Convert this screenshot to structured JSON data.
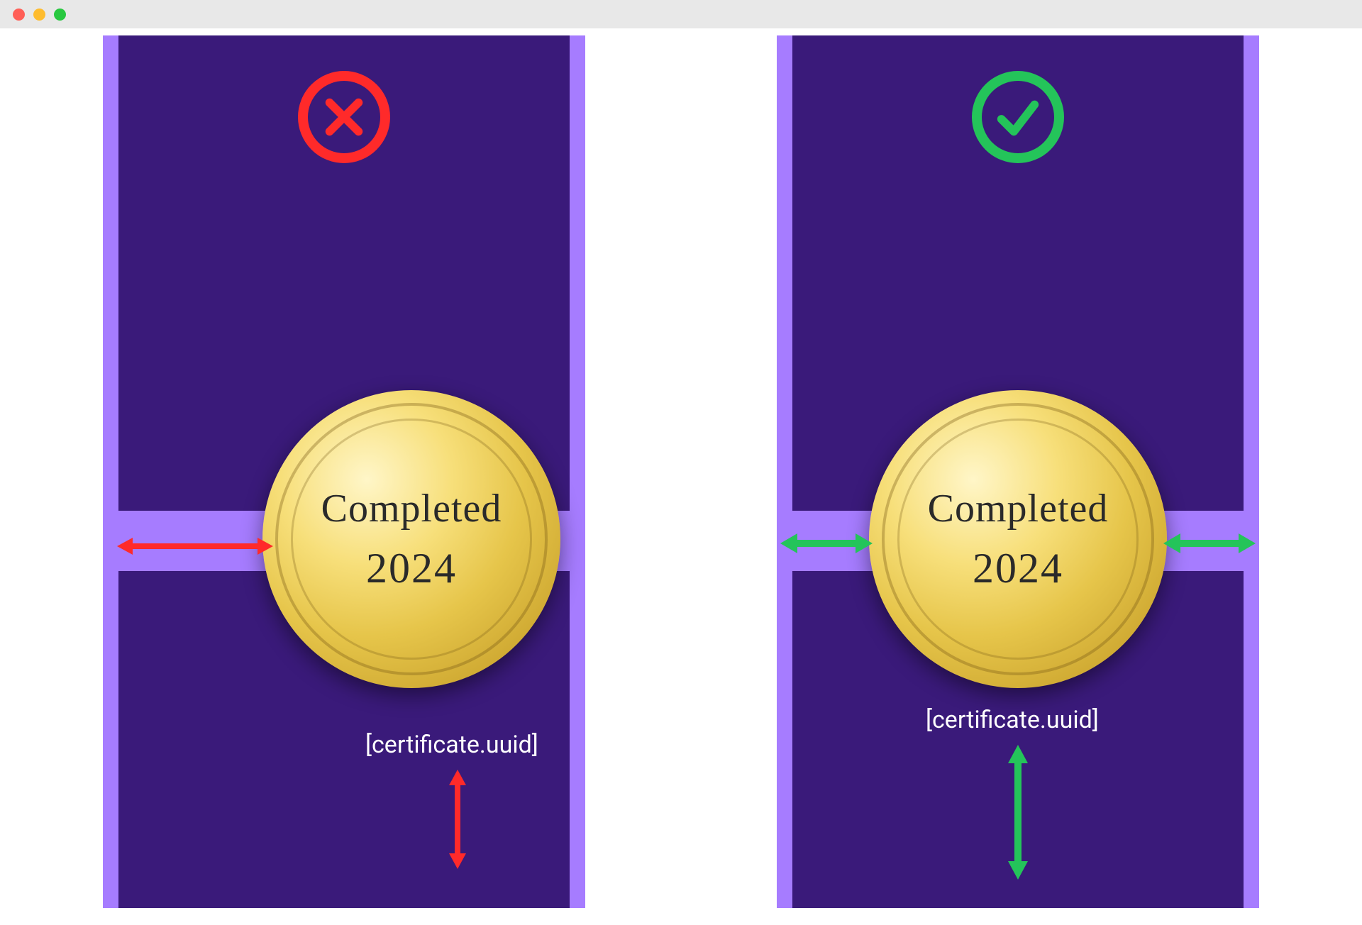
{
  "chrome": {
    "traffic_lights": [
      "close",
      "minimize",
      "zoom"
    ]
  },
  "diagram": {
    "wrong": {
      "status": "incorrect",
      "badge_line1": "Completed",
      "badge_line2": "2024",
      "placeholder": "[certificate.uuid]",
      "badge_alignment": "off-center-left",
      "placeholder_alignment": "off-center-right"
    },
    "right": {
      "status": "correct",
      "badge_line1": "Completed",
      "badge_line2": "2024",
      "placeholder": "[certificate.uuid]",
      "badge_alignment": "centered",
      "placeholder_alignment": "centered"
    }
  },
  "colors": {
    "panel_outer": "#a67cff",
    "panel_inner": "#3a1a7a",
    "wrong": "#ff2a2a",
    "right": "#24c45a"
  },
  "icons": {
    "wrong_status": "x-circle-icon",
    "right_status": "check-circle-icon",
    "h_arrow": "horizontal-double-arrow",
    "v_arrow": "vertical-double-arrow"
  }
}
